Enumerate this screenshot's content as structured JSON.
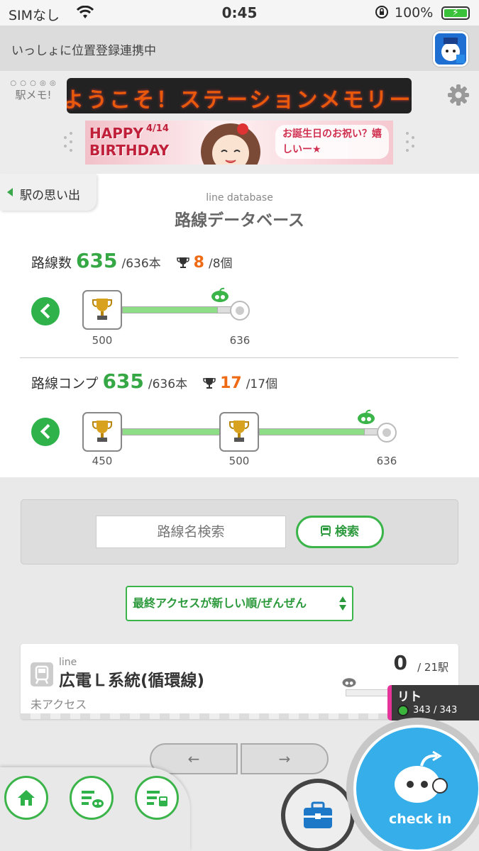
{
  "status_bar": {
    "carrier": "SIMなし",
    "time": "0:45",
    "battery": "100%"
  },
  "share_bar": {
    "text": "いっしょに位置登録連携中"
  },
  "header": {
    "logo_text": "駅メモ!",
    "marquee": "ようこそ！ステーションメモリーズ",
    "banner": {
      "line1": "HAPPY",
      "line2": "BIRTHDAY",
      "date": "4/14",
      "message": "お誕生日のお祝い？嬉しいー★"
    }
  },
  "nav_back": {
    "label": "駅の思い出"
  },
  "page": {
    "subtitle": "line database",
    "title": "路線データベース"
  },
  "line_count": {
    "label": "路線数",
    "value": "635",
    "total": "/636本",
    "trophies": "8",
    "trophies_total": "/8個",
    "ticks": [
      "500",
      "636"
    ]
  },
  "line_complete": {
    "label": "路線コンプ",
    "value": "635",
    "total": "/636本",
    "trophies": "17",
    "trophies_total": "/17個",
    "ticks": [
      "450",
      "500",
      "636"
    ]
  },
  "search": {
    "placeholder": "路線名検索",
    "button": "検索"
  },
  "sort": {
    "label": "最終アクセスが新しい順/ぜんぜん"
  },
  "list": [
    {
      "tag": "line",
      "name": "広電Ｌ系統(循環線)",
      "access": "未アクセス",
      "count": "0",
      "total": "/ 21駅"
    }
  ],
  "partner": {
    "name": "リト",
    "hp": "343 / 343"
  },
  "pager": {
    "prev": "←",
    "next": "→"
  },
  "checkin": {
    "label": "check in"
  },
  "colors": {
    "accent_green": "#3bb44a",
    "orange": "#ee6a14",
    "blue": "#35aeea"
  }
}
